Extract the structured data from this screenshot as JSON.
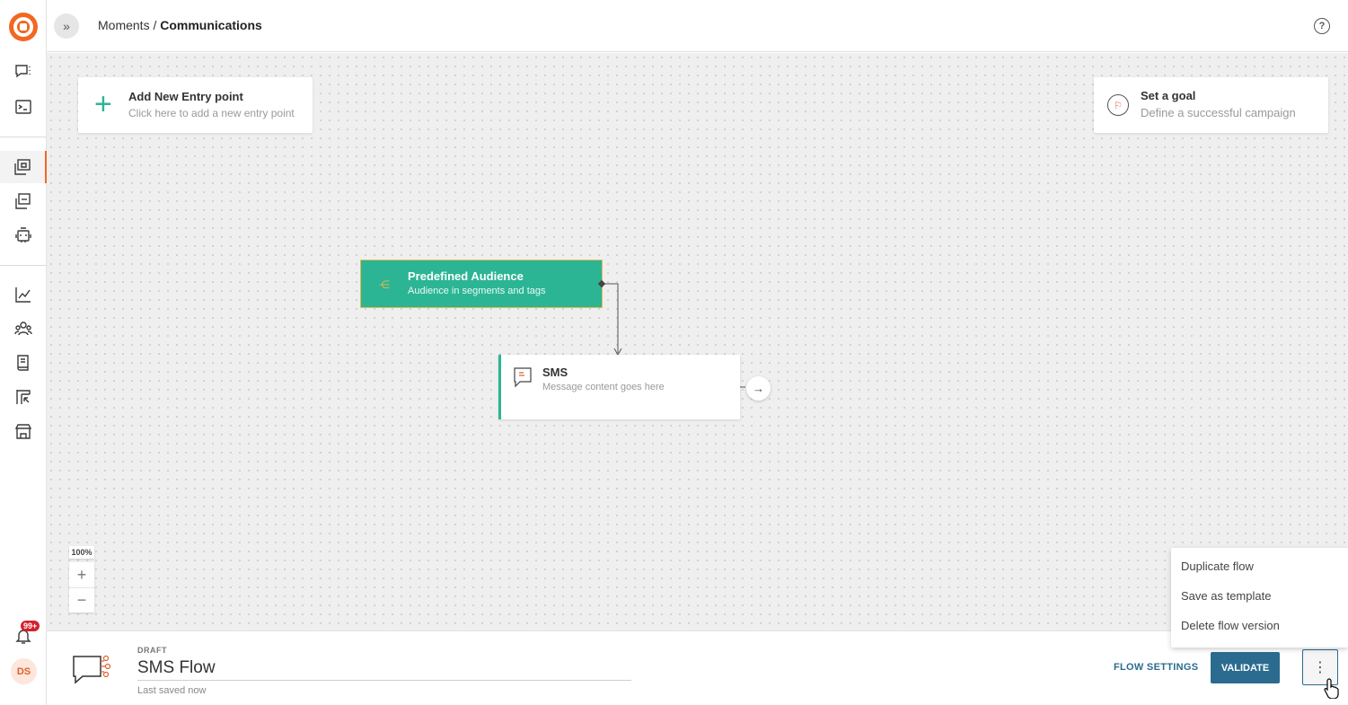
{
  "header": {
    "breadcrumb_parent": "Moments",
    "breadcrumb_sep": " / ",
    "breadcrumb_current": "Communications",
    "expand_icon": "double-chevron-right-icon",
    "help_icon": "?"
  },
  "sidebar": {
    "badge": "99+",
    "avatar_initials": "DS"
  },
  "canvas": {
    "entry": {
      "title": "Add New Entry point",
      "subtitle": "Click here to add a new entry point"
    },
    "goal": {
      "title": "Set a goal",
      "subtitle": "Define a successful campaign"
    },
    "audience_node": {
      "title": "Predefined Audience",
      "subtitle": "Audience in segments and tags"
    },
    "sms_node": {
      "title": "SMS",
      "subtitle": "Message content goes here"
    },
    "zoom_level": "100%",
    "zoom_in": "+",
    "zoom_out": "−"
  },
  "bottom": {
    "status": "DRAFT",
    "flow_name": "SMS Flow",
    "saved_text": "Last saved now",
    "flow_settings": "FLOW SETTINGS",
    "validate": "VALIDATE",
    "more": "⋮"
  },
  "menu": {
    "items": [
      "Duplicate flow",
      "Save as template",
      "Delete flow version"
    ]
  },
  "colors": {
    "brand": "#f26722",
    "node_green": "#2bb594",
    "primary": "#2b6b8f",
    "badge": "#d1222d"
  }
}
